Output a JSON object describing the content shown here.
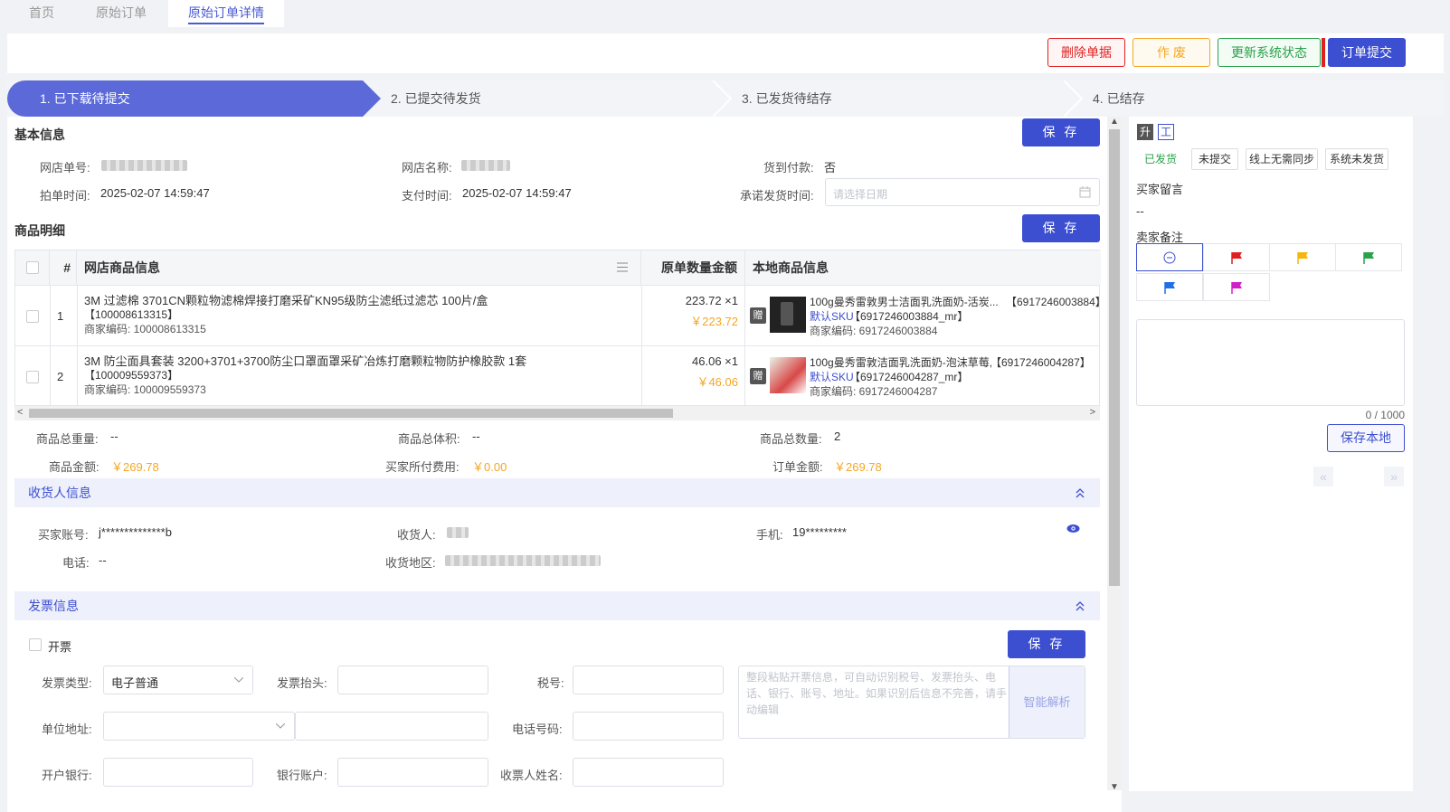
{
  "tabs": [
    {
      "label": "首页"
    },
    {
      "label": "原始订单"
    },
    {
      "label": "原始订单详情"
    }
  ],
  "actions": {
    "delete": "删除单据",
    "void": "作 废",
    "update": "更新系统状态",
    "submit": "订单提交"
  },
  "steps": [
    "1. 已下载待提交",
    "2. 已提交待发货",
    "3. 已发货待结存",
    "4. 已结存"
  ],
  "basic": {
    "title": "基本信息",
    "save": "保 存",
    "shop_order_label": "网店单号:",
    "shop_name_label": "网店名称:",
    "cod_label": "货到付款:",
    "cod_value": "否",
    "order_time_label": "拍单时间:",
    "order_time": "2025-02-07 14:59:47",
    "pay_time_label": "支付时间:",
    "pay_time": "2025-02-07 14:59:47",
    "promise_label": "承诺发货时间:",
    "promise_placeholder": "请选择日期"
  },
  "goods": {
    "title": "商品明细",
    "save": "保 存",
    "headers": {
      "index": "#",
      "shop_info": "网店商品信息",
      "qty_amount": "原单数量金额",
      "local_info": "本地商品信息"
    },
    "rows": [
      {
        "index": "1",
        "name": "3M 过滤棉 3701CN颗粒物滤棉焊接打磨采矿KN95级防尘滤纸过滤芯 100片/盒",
        "code": "【100008613315】",
        "merchant_code": "商家编码:  100008613315",
        "qty": "223.72 ×1",
        "amount": "￥223.72",
        "gift": "赠",
        "local_name": "100g曼秀雷敦男士洁面乳洗面奶-活炭...",
        "local_code": "【6917246003884】",
        "sku_label": "默认SKU",
        "sku": "【6917246003884_mr】",
        "local_merchant": "商家编码:  6917246003884"
      },
      {
        "index": "2",
        "name": "3M 防尘面具套装 3200+3701+3700防尘口罩面罩采矿冶炼打磨颗粒物防护橡胶款 1套",
        "code": "【100009559373】",
        "merchant_code": "商家编码:  100009559373",
        "qty": "46.06 ×1",
        "amount": "￥46.06",
        "gift": "赠",
        "local_name": "100g曼秀雷敦洁面乳洗面奶-泡沫草莓,",
        "local_code": "【6917246004287】",
        "sku_label": "默认SKU",
        "sku": "【6917246004287_mr】",
        "local_merchant": "商家编码:  6917246004287"
      }
    ]
  },
  "summary": {
    "weight_label": "商品总重量:",
    "weight": "--",
    "volume_label": "商品总体积:",
    "volume": "--",
    "count_label": "商品总数量:",
    "count": "2",
    "goods_amount_label": "商品金额:",
    "goods_amount": "￥269.78",
    "buyer_fee_label": "买家所付费用:",
    "buyer_fee": "￥0.00",
    "order_amount_label": "订单金额:",
    "order_amount": "￥269.78"
  },
  "receiver": {
    "title": "收货人信息",
    "account_label": "买家账号:",
    "account": "j**************b",
    "name_label": "收货人:",
    "phone_label": "手机:",
    "phone": "19*********",
    "tel_label": "电话:",
    "tel": "--",
    "area_label": "收货地区:"
  },
  "invoice": {
    "title": "发票信息",
    "checkbox_label": "开票",
    "save": "保 存",
    "type_label": "发票类型:",
    "type_value": "电子普通",
    "header_label": "发票抬头:",
    "tax_label": "税号:",
    "address_label": "单位地址:",
    "phone_label": "电话号码:",
    "bank_label": "开户银行:",
    "account_label": "银行账户:",
    "receiver_label": "收票人姓名:",
    "paste_placeholder": "整段粘贴开票信息，可自动识别税号、发票抬头、电话、银行、账号、地址。如果识别后信息不完善，请手动编辑",
    "parse_button": "智能解析"
  },
  "side": {
    "mode_a": "升",
    "mode_b": "工",
    "status_tags": [
      "已发货",
      "未提交",
      "线上无需同步",
      "系统未发货"
    ],
    "buyer_msg_label": "买家留言",
    "buyer_msg": "--",
    "seller_note_label": "卖家备注",
    "counter": "0 / 1000",
    "save_local": "保存本地"
  },
  "colors": {
    "primary": "#3d4fd1",
    "orange": "#f5a623",
    "red": "#e02020",
    "green": "#2aa14a"
  }
}
